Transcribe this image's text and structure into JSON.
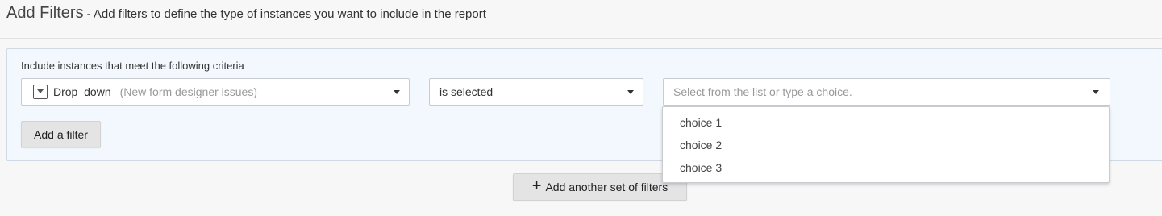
{
  "header": {
    "title": "Add Filters",
    "subtitle": "- Add filters to define the type of instances you want to include in the report"
  },
  "filter_panel": {
    "criteria_label": "Include instances that meet the following criteria",
    "field_select": {
      "icon": "dropdown-field-icon",
      "field_name": "Drop_down",
      "field_source": "(New form designer issues)"
    },
    "operator_select": {
      "value": "is selected"
    },
    "value_select": {
      "placeholder": "Select from the list or type a choice.",
      "options": [
        "choice 1",
        "choice 2",
        "choice 3"
      ]
    },
    "add_filter_label": "Add a filter"
  },
  "footer": {
    "add_set_label": "Add another set of filters",
    "add_set_icon": "plus-icon"
  }
}
